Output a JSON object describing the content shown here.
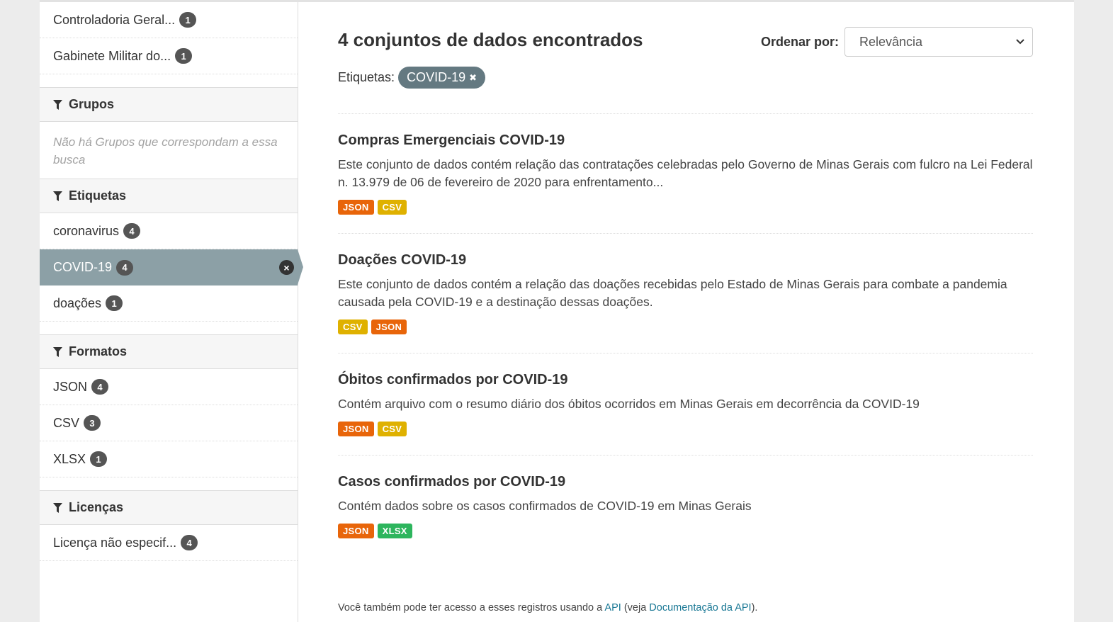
{
  "sidebar": {
    "organizations": [
      {
        "label": "Controladoria Geral...",
        "count": "1"
      },
      {
        "label": "Gabinete Militar do...",
        "count": "1"
      }
    ],
    "groups": {
      "heading": "Grupos",
      "empty_message": "Não há Grupos que correspondam a essa busca"
    },
    "tags": {
      "heading": "Etiquetas",
      "items": [
        {
          "label": "coronavirus",
          "count": "4"
        },
        {
          "label": "COVID-19",
          "count": "4",
          "active": true
        },
        {
          "label": "doações",
          "count": "1"
        }
      ]
    },
    "formats": {
      "heading": "Formatos",
      "items": [
        {
          "label": "JSON",
          "count": "4"
        },
        {
          "label": "CSV",
          "count": "3"
        },
        {
          "label": "XLSX",
          "count": "1"
        }
      ]
    },
    "licenses": {
      "heading": "Licenças",
      "items": [
        {
          "label": "Licença não especif...",
          "count": "4"
        }
      ]
    }
  },
  "main": {
    "heading": "4 conjuntos de dados encontrados",
    "sort_label": "Ordenar por:",
    "sort_value": "Relevância",
    "tags_label": "Etiquetas:",
    "active_tag": "COVID-19",
    "datasets": [
      {
        "title": "Compras Emergenciais COVID-19",
        "description": "Este conjunto de dados contém relação das contratações celebradas pelo Governo de Minas Gerais com fulcro na Lei Federal n. 13.979 de 06 de fevereiro de 2020 para enfrentamento...",
        "formats": [
          "JSON",
          "CSV"
        ]
      },
      {
        "title": "Doações COVID-19",
        "description": "Este conjunto de dados contém a relação das doações recebidas pelo Estado de Minas Gerais para combate a pandemia causada pela COVID-19 e a destinação dessas doações.",
        "formats": [
          "CSV",
          "JSON"
        ]
      },
      {
        "title": "Óbitos confirmados por COVID-19",
        "description": "Contém arquivo com o resumo diário dos óbitos ocorridos em Minas Gerais em decorrência da COVID-19",
        "formats": [
          "JSON",
          "CSV"
        ]
      },
      {
        "title": "Casos confirmados por COVID-19",
        "description": "Contém dados sobre os casos confirmados de COVID-19 em Minas Gerais",
        "formats": [
          "JSON",
          "XLSX"
        ]
      }
    ],
    "footer": {
      "prefix": "Você também pode ter acesso a esses registros usando a ",
      "api_link": "API",
      "middle": " (veja ",
      "docs_link": "Documentação da API",
      "suffix": ")."
    }
  },
  "colors": {
    "JSON": "#e8650a",
    "CSV": "#dfb100",
    "XLSX": "#2db55d",
    "active_facet": "#8ca0a6",
    "tag_pill": "#647981",
    "link": "#187794"
  },
  "icons": {
    "facet_heading": "funnel-icon",
    "remove_facet": "close-circle-icon",
    "remove_tag": "close-icon",
    "select": "chevron-down-icon"
  }
}
